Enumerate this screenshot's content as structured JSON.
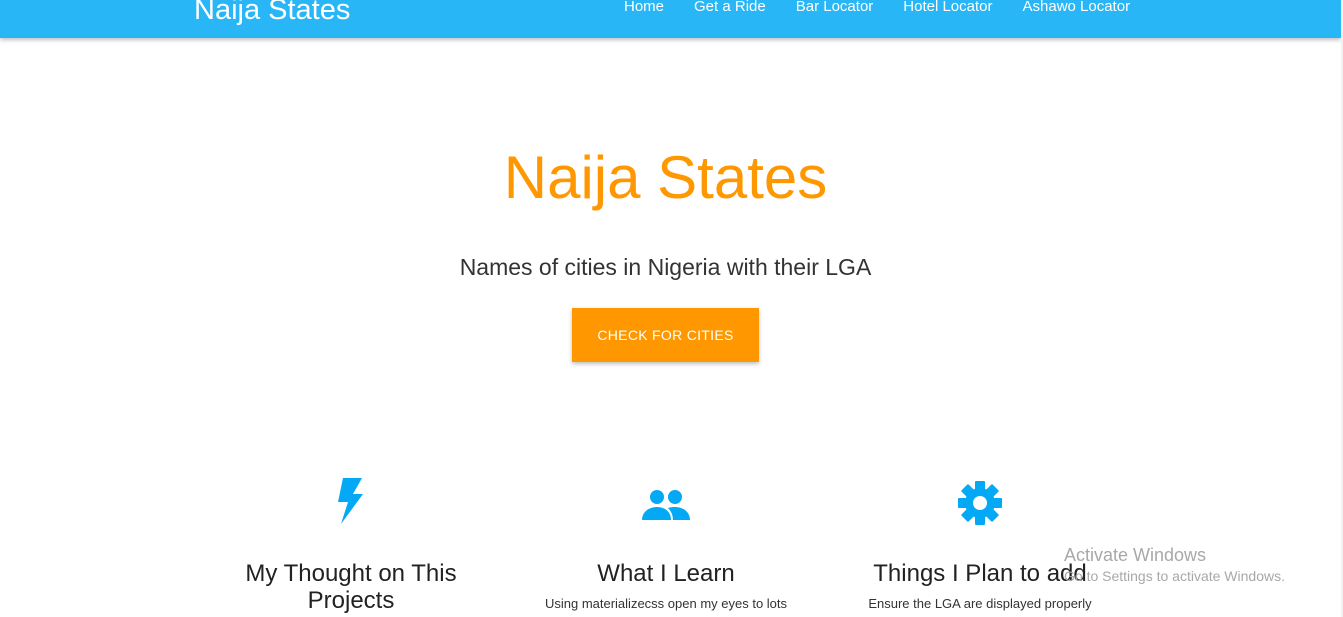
{
  "navbar": {
    "brand": "Naija States",
    "links": [
      "Home",
      "Get a Ride",
      "Bar Locator",
      "Hotel Locator",
      "Ashawo Locator"
    ]
  },
  "hero": {
    "title": "Naija States",
    "subtitle": "Names of cities in Nigeria with their LGA",
    "button_label": "CHECK FOR CITIES"
  },
  "features": [
    {
      "icon": "flash-icon",
      "heading": "My Thought on This Projects",
      "text": "..."
    },
    {
      "icon": "group-icon",
      "heading": "What I Learn",
      "text": "Using materializecss open my eyes to lots"
    },
    {
      "icon": "settings-icon",
      "heading": "Things I Plan to add",
      "text": "Ensure the LGA are displayed properly"
    }
  ],
  "watermark": {
    "title": "Activate Windows",
    "subtitle": "Go to Settings to activate Windows."
  },
  "colors": {
    "navbar": "#29b6f6",
    "accent": "#ff9800",
    "icon": "#03a9f4"
  }
}
